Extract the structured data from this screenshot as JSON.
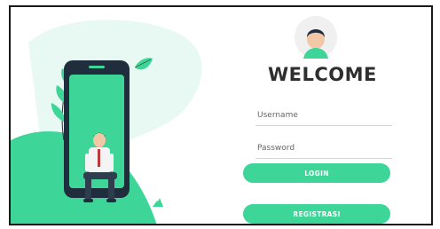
{
  "login_form": {
    "title": "WELCOME",
    "username_placeholder": "Username",
    "password_placeholder": "Password",
    "login_label": "LOGIN",
    "register_label": "REGISTRASI"
  },
  "icons": {
    "avatar": "user-avatar-icon",
    "illustration": "person-in-phone-illustration"
  },
  "colors": {
    "accent": "#3dd598",
    "accent_light": "#e8f8f2",
    "phone_body": "#1f2d3d",
    "phone_screen": "#3dd598",
    "title_text": "#2f2f2f",
    "avatar_bg": "#f0f0f0"
  }
}
